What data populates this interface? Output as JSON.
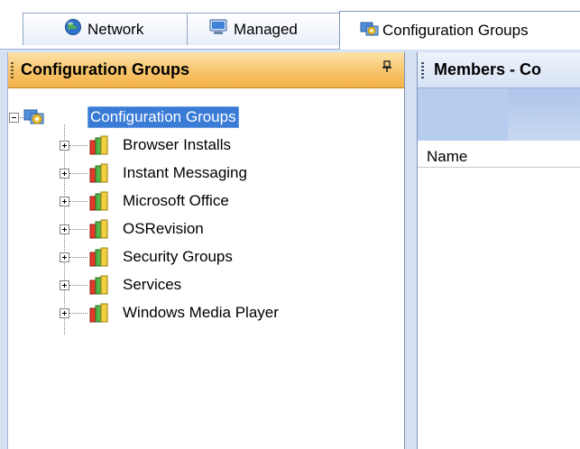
{
  "tabs": [
    {
      "label": "Network",
      "icon": "globe-icon",
      "active": false
    },
    {
      "label": "Managed",
      "icon": "computer-icon",
      "active": false
    },
    {
      "label": "Configuration Groups",
      "icon": "config-groups-icon",
      "active": true
    }
  ],
  "left_panel": {
    "title": "Configuration Groups",
    "pin_glyph": "ᵖ",
    "tree": {
      "root": {
        "label": "Configuration Groups",
        "icon": "config-groups-icon",
        "expanded": true,
        "selected": true
      },
      "children": [
        {
          "label": "Browser Installs",
          "icon": "group-icon"
        },
        {
          "label": "Instant Messaging",
          "icon": "group-icon"
        },
        {
          "label": "Microsoft Office",
          "icon": "group-icon"
        },
        {
          "label": "OSRevision",
          "icon": "group-icon"
        },
        {
          "label": "Security Groups",
          "icon": "group-icon"
        },
        {
          "label": "Services",
          "icon": "group-icon"
        },
        {
          "label": "Windows Media Player",
          "icon": "group-icon"
        }
      ]
    }
  },
  "right_panel": {
    "title": "Members - Co",
    "columns": [
      "Name"
    ]
  },
  "colors": {
    "header_orange": "#f7c46a",
    "selection_blue": "#3a7bd5",
    "pane_frame": "#d5e1f2"
  }
}
